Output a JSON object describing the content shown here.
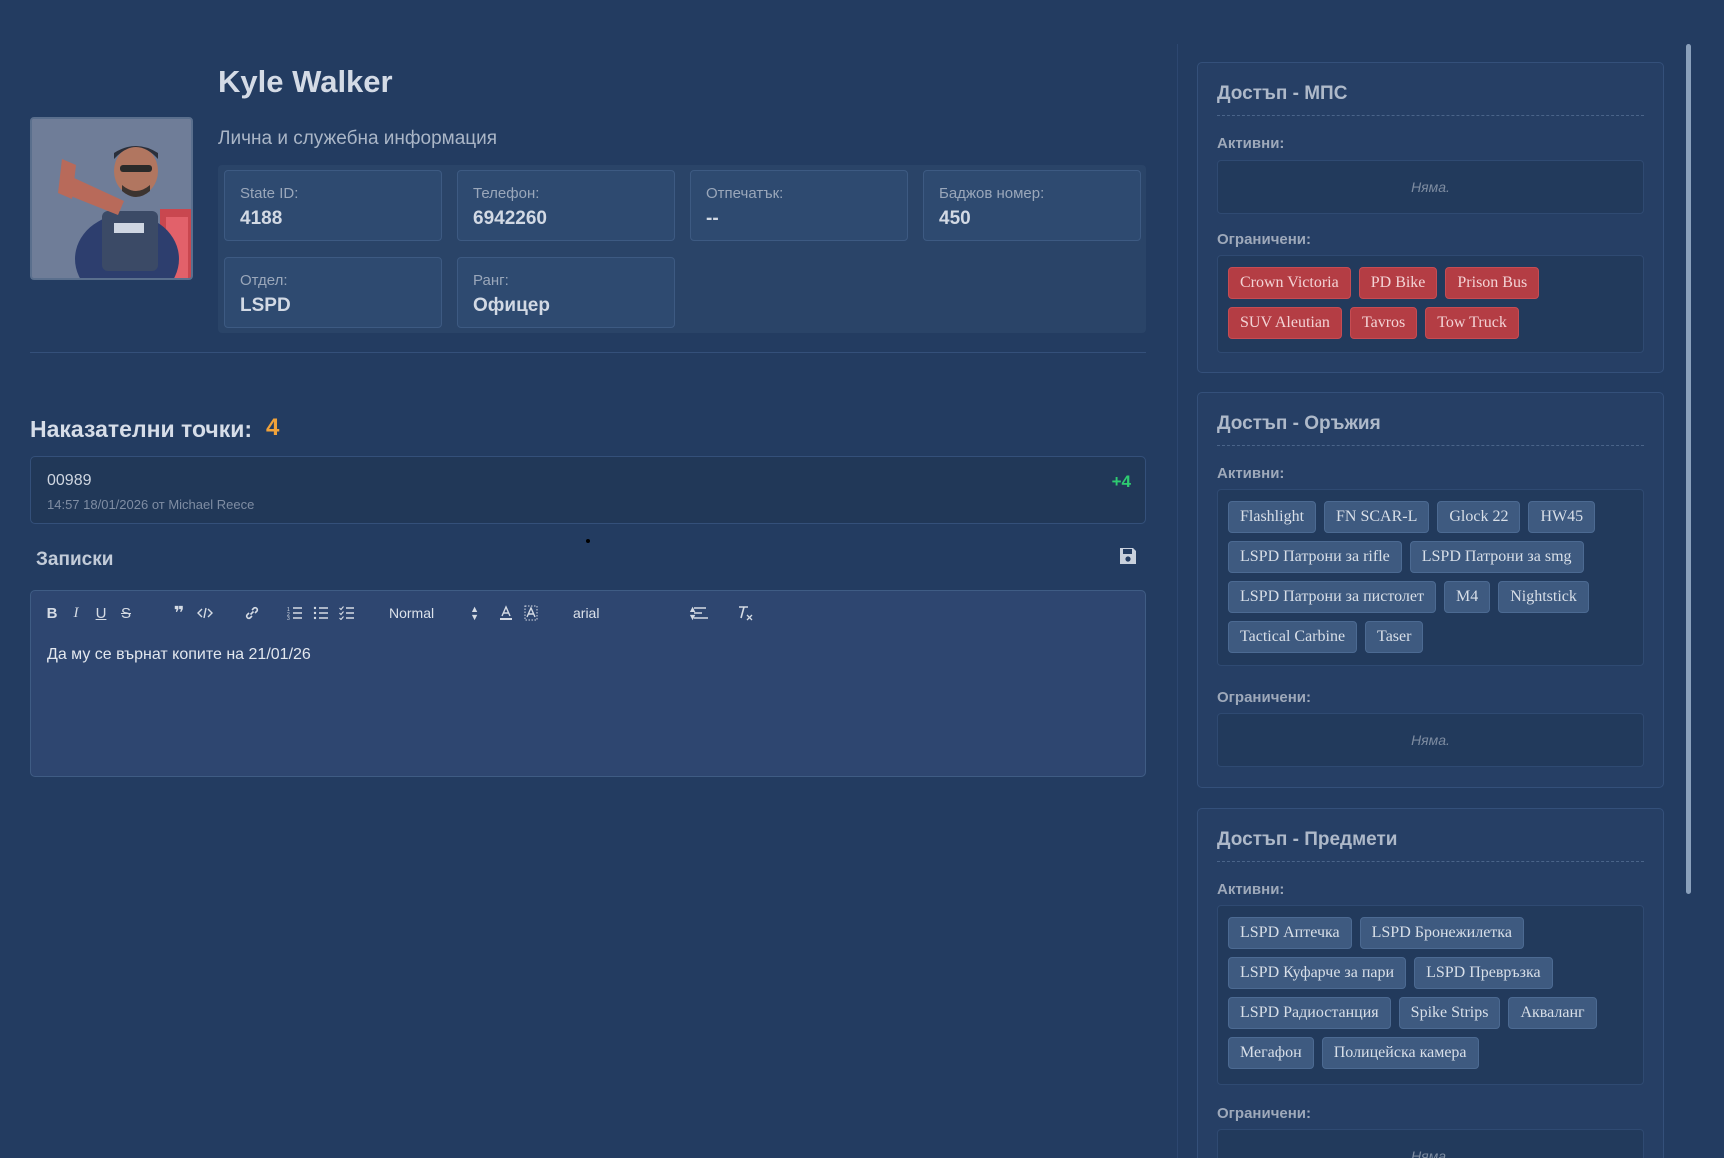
{
  "profile": {
    "name": "Kyle Walker",
    "subtitle": "Лична и служебна информация",
    "avatar_icon": "officer-avatar",
    "fields": [
      {
        "label": "State ID:",
        "value": "4188"
      },
      {
        "label": "Телефон:",
        "value": "6942260"
      },
      {
        "label": "Отпечатък:",
        "value": "--"
      },
      {
        "label": "Баджов номер:",
        "value": "450"
      },
      {
        "label": "Отдел:",
        "value": "LSPD"
      },
      {
        "label": "Ранг:",
        "value": "Офицер"
      }
    ]
  },
  "penalty": {
    "title": "Наказателни точки:",
    "count": "4",
    "count_color": "#f0a23a",
    "entries": [
      {
        "code": "00989",
        "meta": "14:57 18/01/2026 от Michael Reece",
        "points": "+4"
      }
    ]
  },
  "notes": {
    "title": "Записки",
    "save_icon": "save-icon",
    "toolbar": {
      "header_select": "Normal",
      "font_select": "arial"
    },
    "content": "Да му се върнат копите на 21/01/26"
  },
  "access": {
    "active_label": "Активни:",
    "restricted_label": "Ограничени:",
    "empty_text": "Няма.",
    "vehicles": {
      "title": "Достъп - МПС",
      "active": [],
      "restricted": [
        "Crown Victoria",
        "PD Bike",
        "Prison Bus",
        "SUV Aleutian",
        "Tavros",
        "Tow Truck"
      ]
    },
    "weapons": {
      "title": "Достъп - Оръжия",
      "active": [
        "Flashlight",
        "FN SCAR-L",
        "Glock 22",
        "HW45",
        "LSPD Патрони за rifle",
        "LSPD Патрони за smg",
        "LSPD Патрони за пистолет",
        "M4",
        "Nightstick",
        "Tactical Carbine",
        "Taser"
      ],
      "restricted": []
    },
    "items": {
      "title": "Достъп - Предмети",
      "active": [
        "LSPD Аптечка",
        "LSPD Бронежилетка",
        "LSPD Куфарче за пари",
        "LSPD Превръзка",
        "LSPD Радиостанция",
        "Spike Strips",
        "Акваланг",
        "Мегафон",
        "Полицейска камера"
      ],
      "restricted": []
    }
  },
  "colors": {
    "background": "#233c61",
    "restricted_tag": "#b43d44",
    "active_tag": "#3e5a80",
    "points_positive": "#2ecc71"
  }
}
